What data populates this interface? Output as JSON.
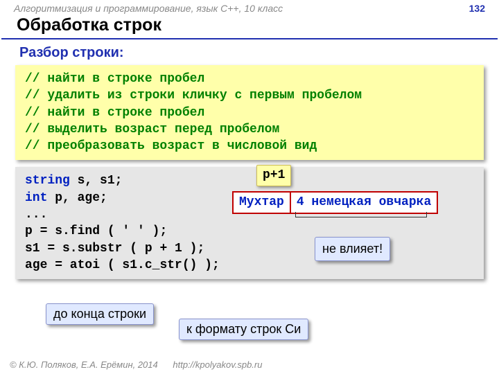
{
  "header": {
    "course": "Алгоритмизация и программирование, язык C++, 10 класс",
    "page": "132"
  },
  "title": "Обработка строк",
  "section": "Разбор строки:",
  "comments": {
    "c1": "// найти в строке пробел",
    "c2": "// удалить из строки кличку с первым пробелом",
    "c3": "// найти в строке пробел",
    "c4": "// выделить возраст перед пробелом",
    "c5": "// преобразовать возраст в числовой вид"
  },
  "code": {
    "kw_string": "string",
    "decl1_rest": " s, s1;",
    "kw_int": "int",
    "decl2_rest": " p, age;",
    "dots": "...",
    "l4a": "p = s.find",
    "l4b": " ( ' ' );",
    "l5a": "s1 = s.substr",
    "l5b": " ( p + 1 );",
    "l6a": "age = atoi",
    "l6b": " ( s1.c_str() );"
  },
  "labels": {
    "p_plus_1": "p+1",
    "cell1": "Мухтар",
    "cell2": "4 немецкая овчарка",
    "no_effect": "не влияет!",
    "to_end": "до конца строки",
    "c_format": "к формату строк Си"
  },
  "footer": {
    "copy": "© К.Ю. Поляков, Е.А. Ерёмин, 2014",
    "url": "http://kpolyakov.spb.ru"
  }
}
